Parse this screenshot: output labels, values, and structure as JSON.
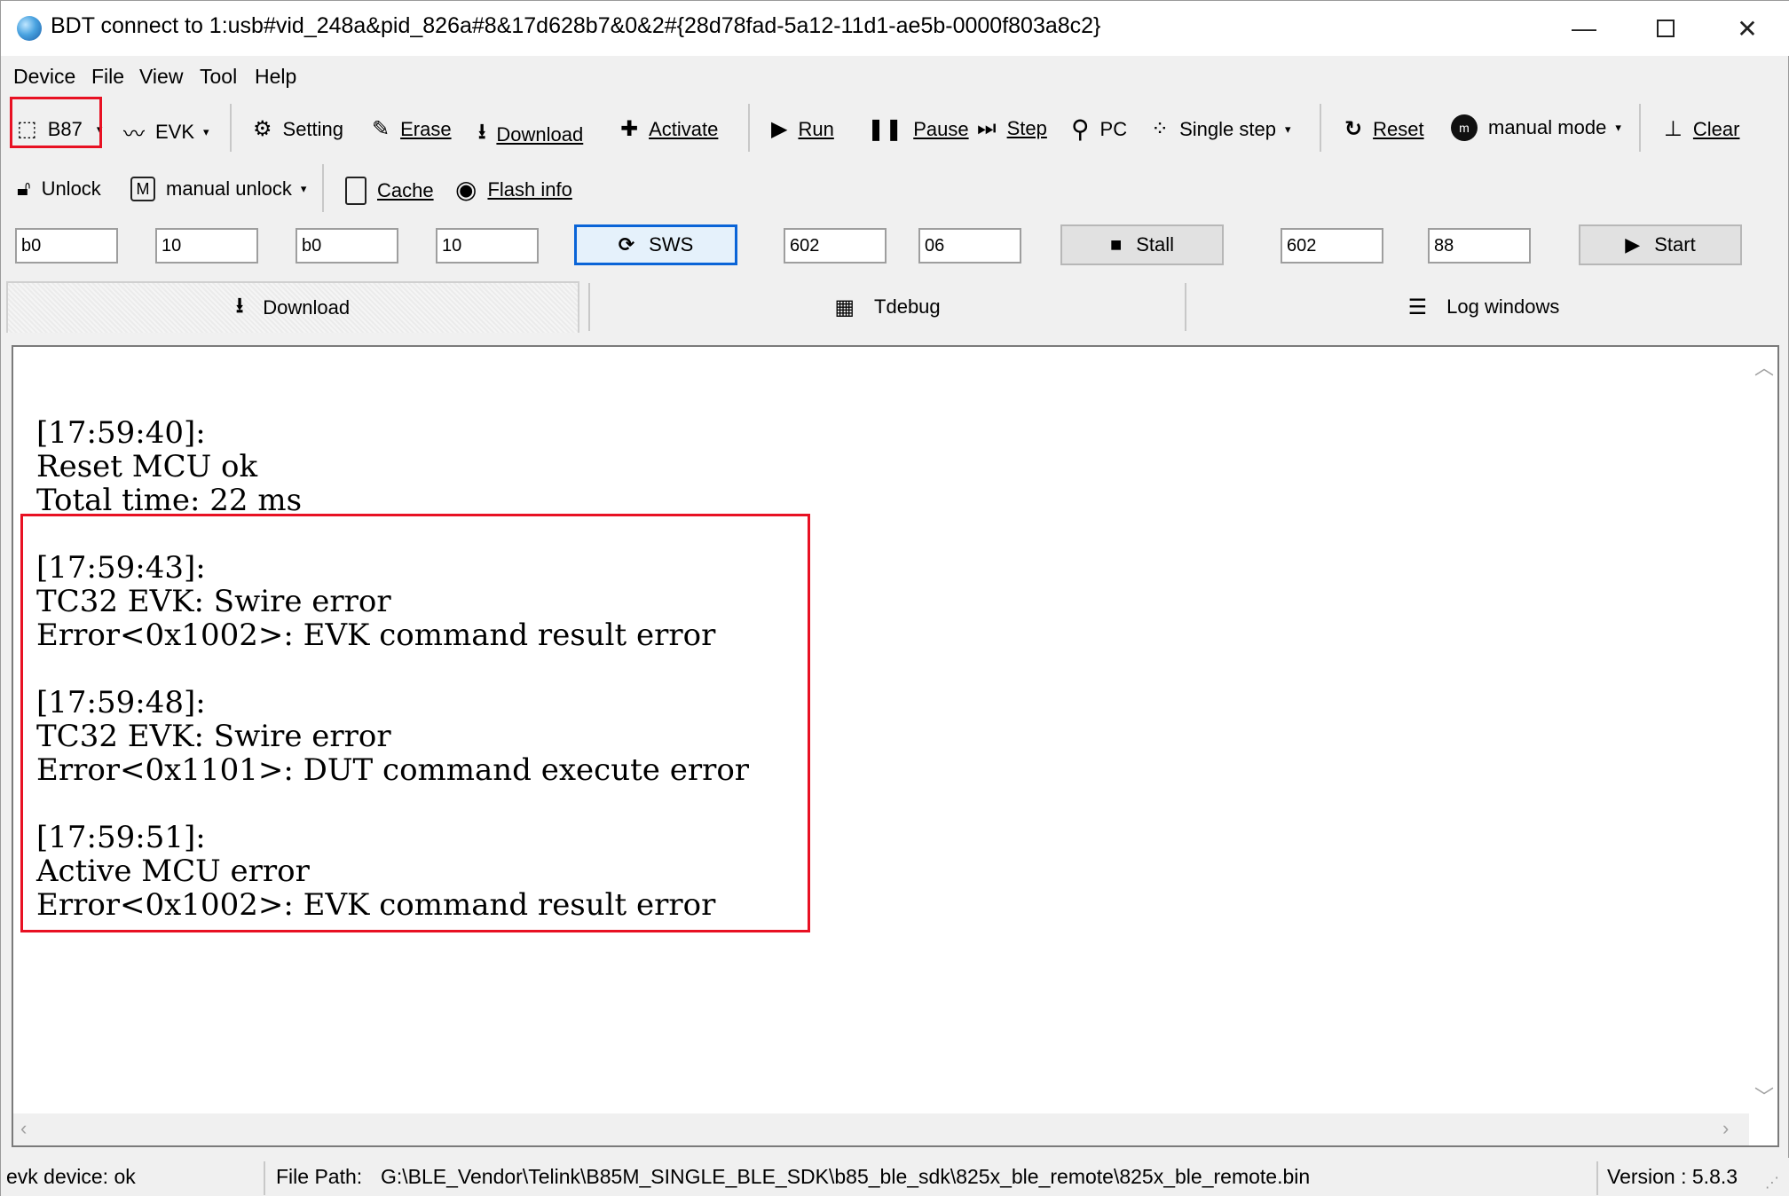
{
  "window": {
    "title": "BDT connect to 1:usb#vid_248a&pid_826a#8&17d628b7&0&2#{28d78fad-5a12-11d1-ae5b-0000f803a8c2}",
    "minimize": "—",
    "close": "✕"
  },
  "menu": [
    "Device",
    "File",
    "View",
    "Tool",
    "Help"
  ],
  "toolbar1": {
    "chip": "B87",
    "evk": "EVK",
    "setting": "Setting",
    "erase": "Erase",
    "download": "Download",
    "activate": "Activate",
    "run": "Run",
    "pause": "Pause",
    "step": "Step",
    "pc": "PC",
    "single_step": "Single step",
    "reset": "Reset",
    "mode": "manual mode",
    "clear": "Clear"
  },
  "toolbar2": {
    "unlock": "Unlock",
    "manual_unlock": "manual unlock",
    "cache": "Cache",
    "flash_info": "Flash info"
  },
  "fields": {
    "f1": "b0",
    "f2": "10",
    "f3": "b0",
    "f4": "10",
    "sws": "SWS",
    "f5": "602",
    "f6": "06",
    "stall": "Stall",
    "f7": "602",
    "f8": "88",
    "start": "Start"
  },
  "tabs": [
    "Download",
    "Tdebug",
    "Log windows"
  ],
  "log": [
    "[17:59:40]:",
    "Reset MCU ok",
    "Total time: 22 ms",
    "",
    "[17:59:43]:",
    "TC32 EVK: Swire error",
    "Error<0x1002>: EVK command result error",
    "",
    "[17:59:48]:",
    "TC32 EVK: Swire error",
    "Error<0x1101>: DUT command execute error",
    "",
    "[17:59:51]:",
    "Active MCU error",
    "Error<0x1002>: EVK command result error"
  ],
  "status": {
    "device": "evk device: ok",
    "file_path_label": "File Path:",
    "file_path": "G:\\BLE_Vendor\\Telink\\B85M_SINGLE_BLE_SDK\\b85_ble_sdk\\825x_ble_remote\\825x_ble_remote.bin",
    "version": "Version : 5.8.3"
  },
  "colors": {
    "highlight": "#e81123",
    "focus": "#0a64d7"
  }
}
